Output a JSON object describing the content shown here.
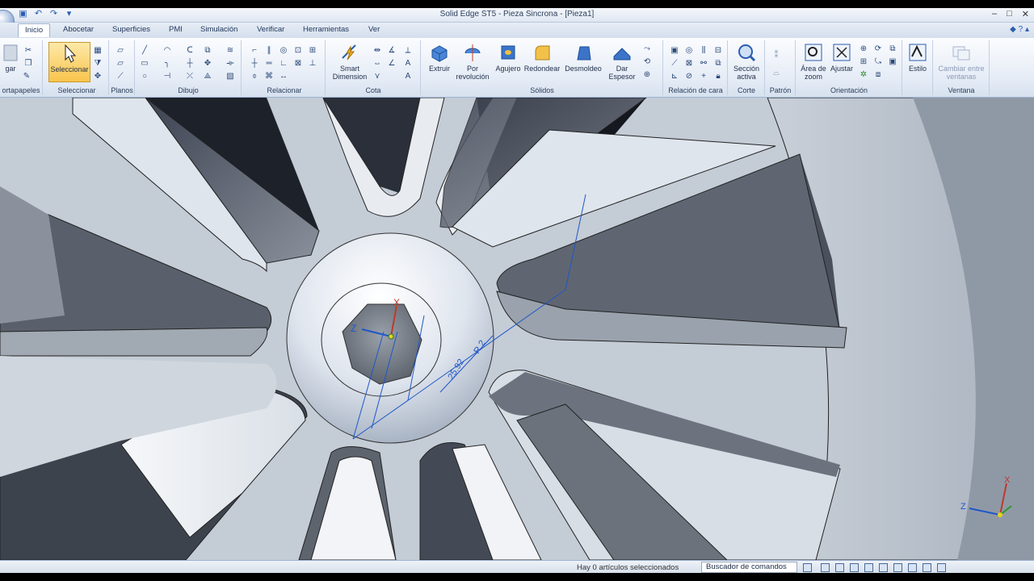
{
  "window": {
    "title": "Solid Edge ST5 - Pieza Sincrona - [Pieza1]"
  },
  "tabs": [
    "Inicio",
    "Abocetar",
    "Superficies",
    "PMI",
    "Simulación",
    "Verificar",
    "Herramientas",
    "Ver"
  ],
  "groups": {
    "portapapeles": "ortapapeles",
    "seleccionar": "Seleccionar",
    "planos": "Planos",
    "dibujo": "Dibujo",
    "relacionar": "Relacionar",
    "cota": "Cota",
    "solidos": "Sólidos",
    "relacion_cara": "Relación de cara",
    "corte": "Corte",
    "patron": "Patrón",
    "orientacion": "Orientación",
    "ventana": "Ventana"
  },
  "buttons": {
    "pegar": "gar",
    "seleccionar": "Seleccionar",
    "smart_dimension_1": "Smart",
    "smart_dimension_2": "Dimension",
    "extruir": "Extruir",
    "por_revolucion_1": "Por",
    "por_revolucion_2": "revolución",
    "agujero": "Agujero",
    "redondear": "Redondear",
    "desmoldeo": "Desmoldeo",
    "dar_espesor_1": "Dar",
    "dar_espesor_2": "Espesor",
    "seccion_activa_1": "Sección",
    "seccion_activa_2": "activa",
    "area_zoom_1": "Área de",
    "area_zoom_2": "zoom",
    "ajustar": "Ajustar",
    "estilo": "Estilo",
    "cambiar_ventanas_1": "Cambiar entre",
    "cambiar_ventanas_2": "ventanas"
  },
  "viewport": {
    "dimension_labels": [
      "Z",
      "X"
    ],
    "triad_labels": [
      "Z",
      "X"
    ],
    "colors": {
      "bg": "#b9c3cf",
      "spoke_dark": "#5b6270",
      "spoke_light": "#e9eef3",
      "dim_line": "#1f57c8"
    }
  },
  "status": {
    "message": "Hay 0 artículos seleccionados",
    "command_finder": "Buscador de comandos"
  }
}
